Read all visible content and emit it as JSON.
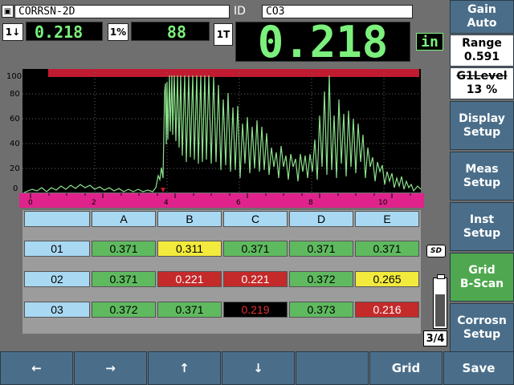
{
  "header": {
    "file_name": "CORRSN-2D",
    "id_label": "ID",
    "id_value": "CO3",
    "min_icon": "1↓",
    "min_value": "0.218",
    "pct_icon": "1%",
    "pct_value": "88",
    "thk_icon": "1T",
    "thickness": "0.218",
    "unit": "in"
  },
  "waveform": {
    "y_ticks": [
      "100",
      "80",
      "60",
      "40",
      "20",
      "0"
    ],
    "x_ticks": [
      "0",
      "2",
      "4",
      "6",
      "8",
      "10"
    ]
  },
  "grid": {
    "columns": [
      "A",
      "B",
      "C",
      "D",
      "E"
    ],
    "rows": [
      {
        "label": "01",
        "cells": [
          "0.371",
          "0.311",
          "0.371",
          "0.371",
          "0.371"
        ]
      },
      {
        "label": "02",
        "cells": [
          "0.371",
          "0.221",
          "0.221",
          "0.372",
          "0.265"
        ]
      },
      {
        "label": "03",
        "cells": [
          "0.372",
          "0.371",
          "0.219",
          "0.373",
          "0.216"
        ]
      }
    ],
    "cell_colors": [
      [
        "#5fba5f",
        "#f2ea3c",
        "#5fba5f",
        "#5fba5f",
        "#5fba5f"
      ],
      [
        "#5fba5f",
        "#c42a2a",
        "#c42a2a",
        "#5fba5f",
        "#f2ea3c"
      ],
      [
        "#5fba5f",
        "#5fba5f",
        "#000000",
        "#5fba5f",
        "#c42a2a"
      ]
    ]
  },
  "menu": {
    "gain": [
      "Gain",
      "Auto"
    ],
    "range": [
      "Range",
      "0.591"
    ],
    "g1level": [
      "G1Level",
      "13 %"
    ],
    "display": [
      "Display",
      "Setup"
    ],
    "meas": [
      "Meas",
      "Setup"
    ],
    "inst": [
      "Inst",
      "Setup"
    ],
    "grid": [
      "Grid",
      "B-Scan"
    ],
    "corrosn": [
      "Corrosn",
      "Setup"
    ]
  },
  "status": {
    "sd_label": "SD",
    "page": "3/4"
  },
  "bottom": {
    "left": "←",
    "right": "→",
    "up": "↑",
    "down": "↓",
    "blank": "",
    "grid": "Grid",
    "save": "Save"
  },
  "colors": {
    "accent_green": "#7cf07c",
    "gate_red": "#c01b30",
    "ruler_magenta": "#e0238c",
    "menu_blue": "#4a6e8a"
  }
}
